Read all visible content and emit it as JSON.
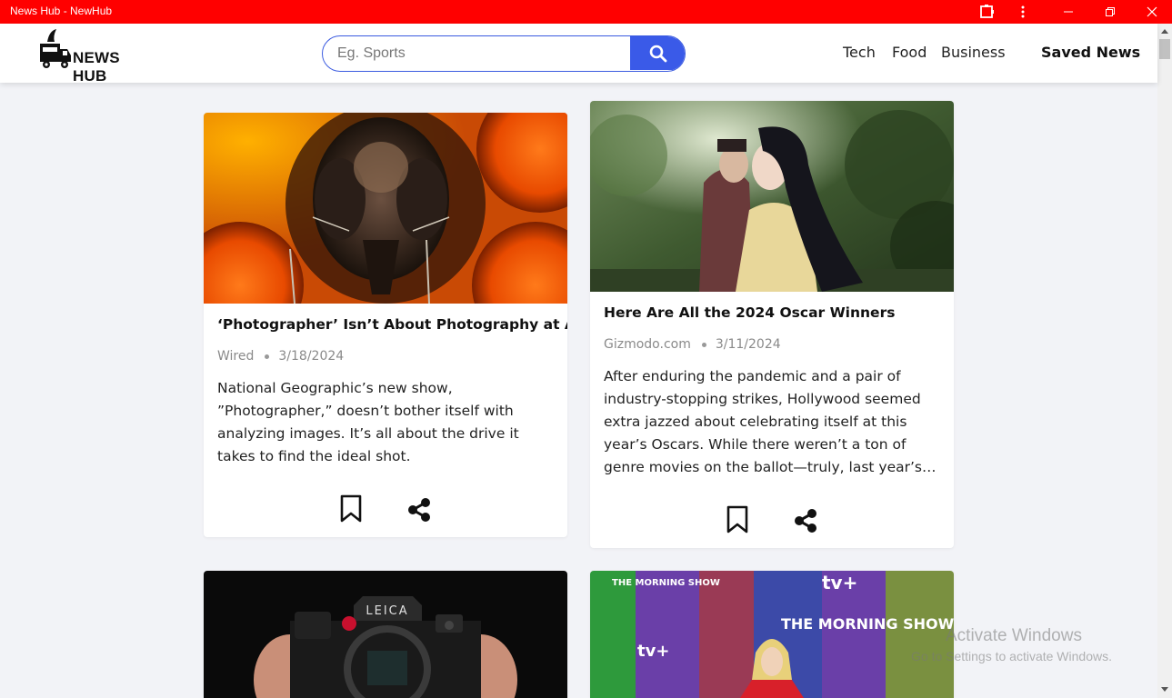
{
  "window": {
    "title": "News Hub - NewHub"
  },
  "header": {
    "logo_text": "NEWS HUB",
    "search_placeholder": "Eg. Sports",
    "nav": [
      "Tech",
      "Food",
      "Business"
    ],
    "saved_label": "Saved News"
  },
  "articles": [
    {
      "title": "‘Photographer’ Isn’t About Photography at All",
      "source": "Wired",
      "date": "3/18/2024",
      "description": "National Geographic’s new show, ”Photographer,” doesn’t bother itself with analyzing images. It’s all about the drive it takes to find the ideal shot.",
      "image": "bee-closeup"
    },
    {
      "title": "Here Are All the 2024 Oscar Winners",
      "source": "Gizmodo.com",
      "date": "3/11/2024",
      "description": "After enduring the pandemic and a pair of industry-stopping strikes, Hollywood seemed extra jazzed about celebrating itself at this year’s Oscars. While there weren’t a ton of genre movies on the ballot—truly, last year’s…",
      "image": "film-still-forest"
    },
    {
      "image": "leica-camera",
      "image_text": "LEICA"
    },
    {
      "image": "morning-show-backdrop",
      "image_text": [
        "THE MORNING SHOW",
        "tv+",
        "THE MORNING SHOW",
        "tv+"
      ]
    }
  ],
  "watermark": {
    "line1": "Activate Windows",
    "line2": "Go to Settings to activate Windows."
  },
  "colors": {
    "titlebar": "#ff0000",
    "accent": "#3a5ae8",
    "background": "#f2f3f7"
  }
}
